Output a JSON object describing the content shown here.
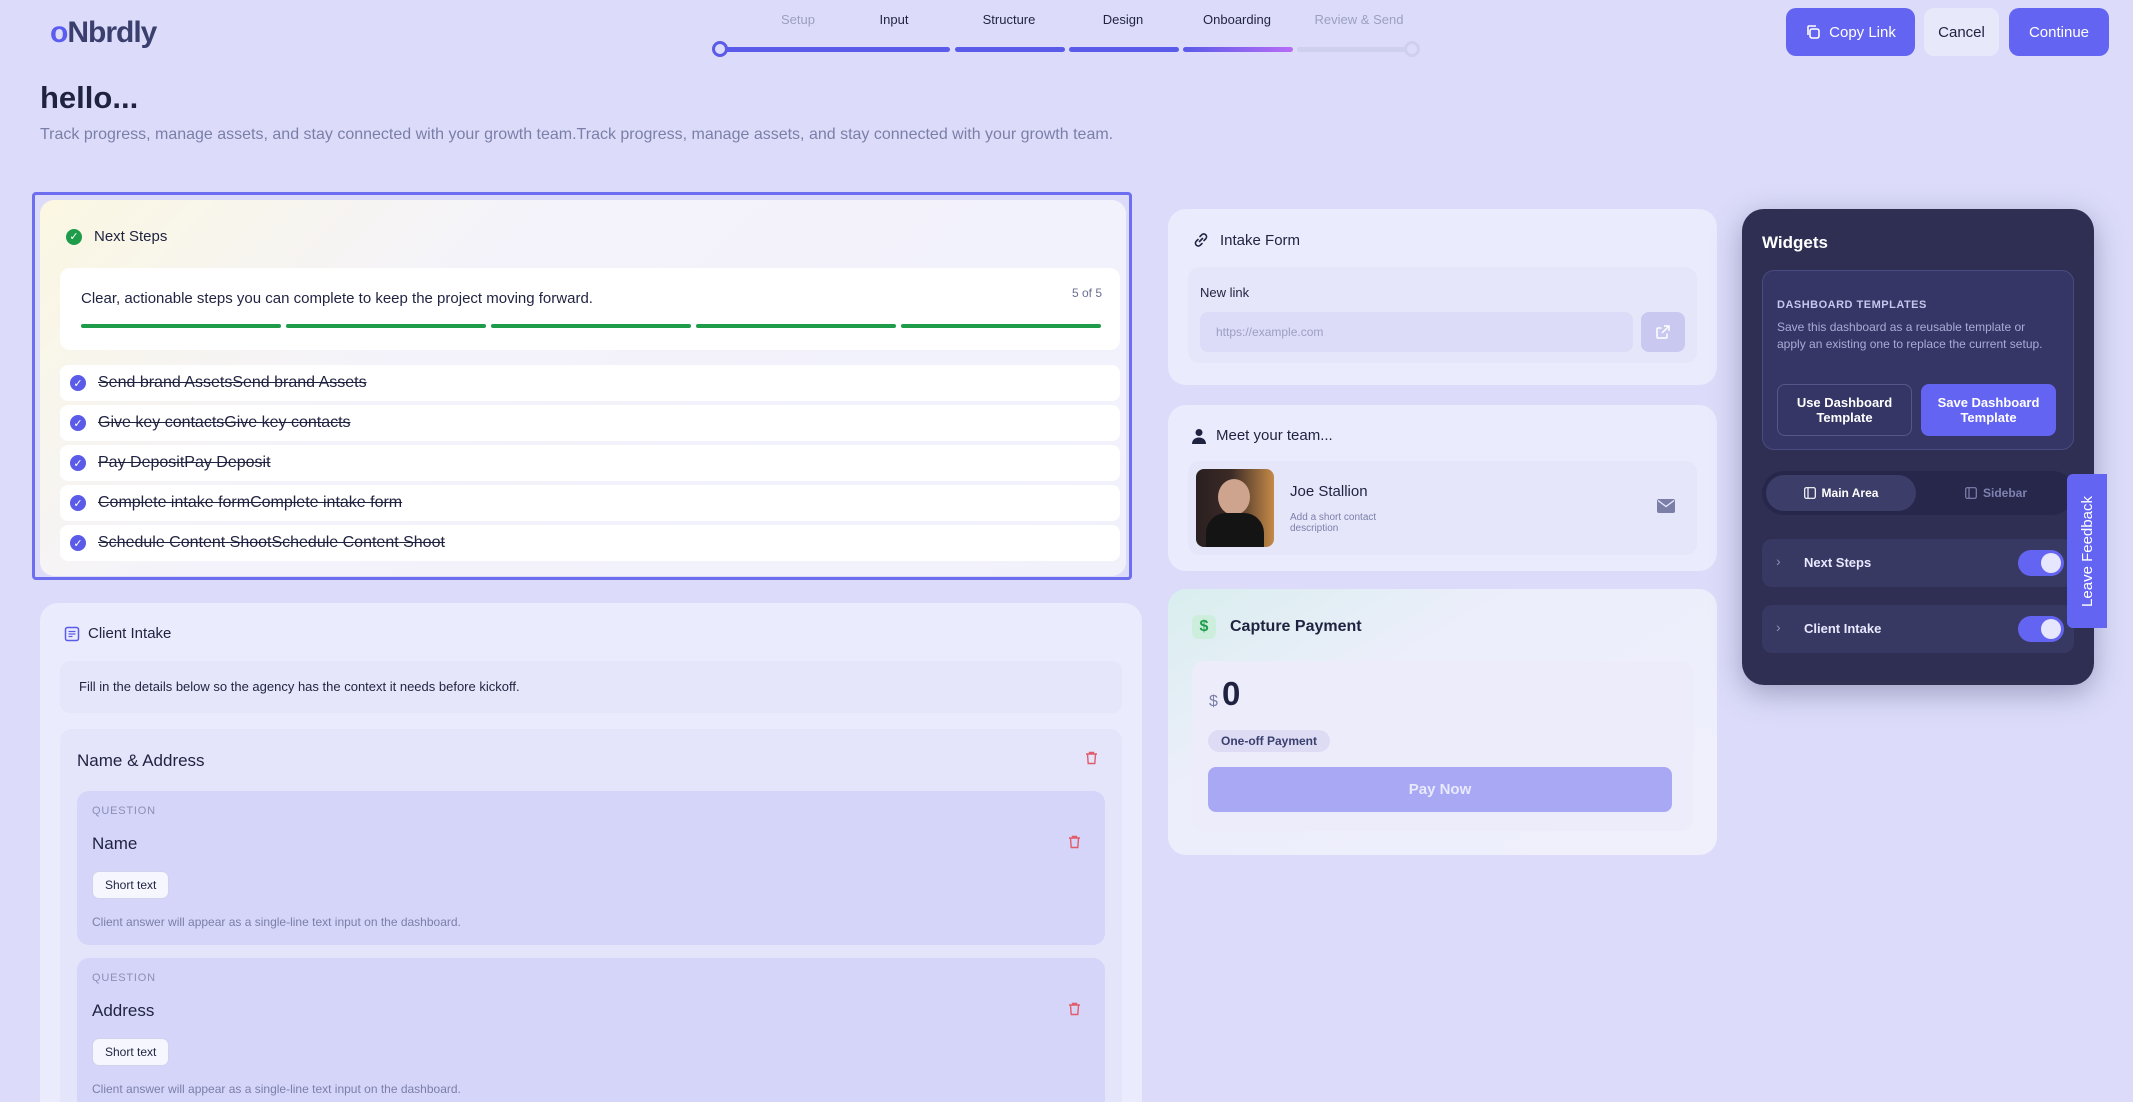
{
  "header": {
    "logo_text": "Nbrdly",
    "logo_prefix": "o",
    "steps": [
      "Setup",
      "Input",
      "Structure",
      "Design",
      "Onboarding",
      "Review & Send"
    ],
    "copy_link_label": "Copy Link",
    "cancel_label": "Cancel",
    "continue_label": "Continue"
  },
  "page": {
    "title": "hello...",
    "subtitle": "Track progress, manage assets, and stay connected with your growth team.Track progress, manage assets, and stay connected with your growth team."
  },
  "next_steps": {
    "title": "Next Steps",
    "description": "Clear, actionable steps you can complete to keep the project moving forward.",
    "count": "5 of 5",
    "progress": {
      "done": 5,
      "total": 5
    },
    "tasks": [
      "Send brand AssetsSend brand Assets",
      "Give key contactsGive key contacts",
      "Pay DepositPay Deposit",
      "Complete intake formComplete intake form",
      "Schedule Content ShootSchedule Content Shoot"
    ]
  },
  "client_intake": {
    "title": "Client Intake",
    "description": "Fill in the details below so the agency has the context it needs before kickoff.",
    "section_title": "Name & Address",
    "questions": [
      {
        "label": "QUESTION",
        "name": "Name",
        "type": "Short text",
        "hint": "Client answer will appear as a single-line text input on the dashboard."
      },
      {
        "label": "QUESTION",
        "name": "Address",
        "type": "Short text",
        "hint": "Client answer will appear as a single-line text input on the dashboard."
      }
    ]
  },
  "intake_form": {
    "title": "Intake Form",
    "field_label": "New link",
    "placeholder": "https://example.com"
  },
  "team": {
    "title": "Meet your team...",
    "member_name": "Joe Stallion",
    "member_desc": "Add a short contact description"
  },
  "payment": {
    "title": "Capture Payment",
    "currency": "$",
    "amount": "0",
    "badge": "One-off Payment",
    "pay_label": "Pay Now"
  },
  "widgets": {
    "title": "Widgets",
    "templates_heading": "DASHBOARD TEMPLATES",
    "templates_desc": "Save this dashboard as a reusable template or apply an existing one to replace the current setup.",
    "use_label": "Use Dashboard Template",
    "save_label": "Save Dashboard Template",
    "tab_main": "Main Area",
    "tab_sidebar": "Sidebar",
    "items": [
      {
        "label": "Next Steps",
        "enabled": true
      },
      {
        "label": "Client Intake",
        "enabled": true
      }
    ]
  },
  "feedback_label": "Leave Feedback",
  "colors": {
    "accent": "#6464f2",
    "success": "#1f9c4a",
    "danger": "#e25b6a",
    "background": "#dcdcfa",
    "panel_dark": "#2e2f52"
  }
}
